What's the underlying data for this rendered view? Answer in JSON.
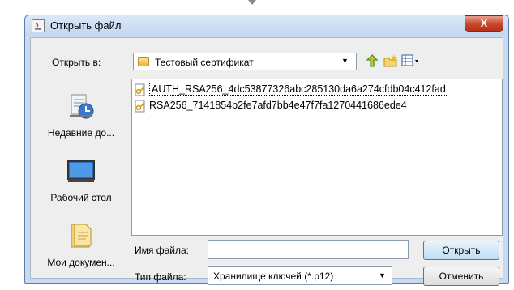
{
  "dialog": {
    "title": "Открыть файл",
    "close_label": "X"
  },
  "look_in": {
    "label": "Открыть в:",
    "value": "Тестовый сертификат"
  },
  "sidebar": {
    "items": [
      {
        "label": "Недавние до...",
        "icon": "recent-documents-icon"
      },
      {
        "label": "Рабочий стол",
        "icon": "desktop-icon"
      },
      {
        "label": "Мои докумен...",
        "icon": "my-documents-icon"
      }
    ]
  },
  "files": [
    {
      "name": "AUTH_RSA256_4dc53877326abc285130da6a274cfdb04c412fad",
      "icon": "key-file-icon"
    },
    {
      "name": "RSA256_7141854b2fe7afd7bb4e47f7fa1270441686ede4",
      "icon": "key-file-icon"
    }
  ],
  "filename": {
    "label": "Имя файла:",
    "value": ""
  },
  "filetype": {
    "label": "Тип файла:",
    "value": "Хранилище ключей (*.p12)"
  },
  "buttons": {
    "open": "Открыть",
    "cancel": "Отменить"
  },
  "colors": {
    "window_frame": "#c9daf0",
    "close_button": "#c7452d",
    "open_button_border": "#3c7fb1"
  }
}
